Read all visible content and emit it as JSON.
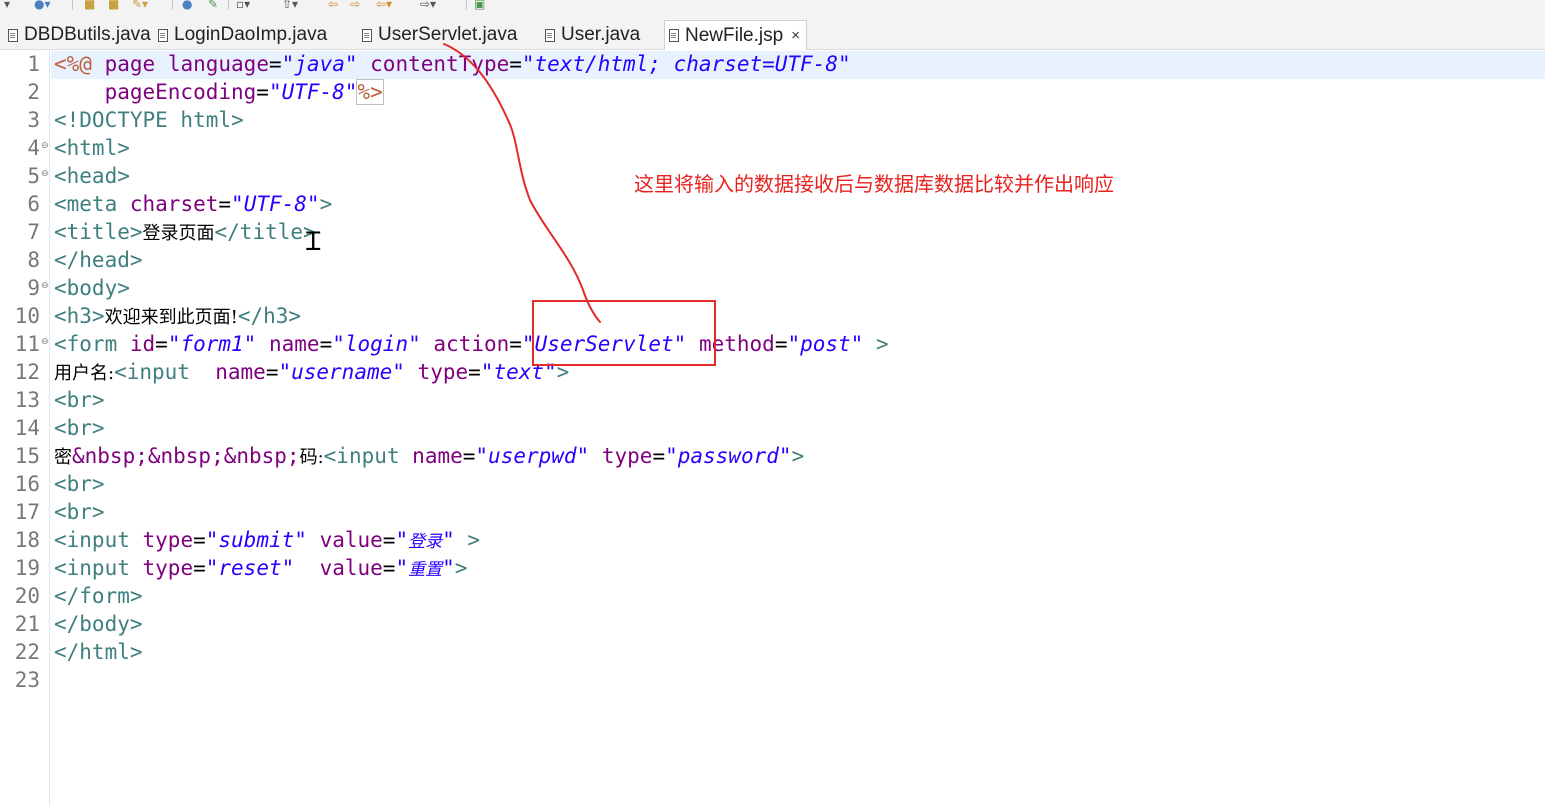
{
  "tabs": [
    {
      "label": "DBDButils.java",
      "active": false
    },
    {
      "label": "LoginDaoImp.java",
      "active": false
    },
    {
      "label": "UserServlet.java",
      "active": false
    },
    {
      "label": "User.java",
      "active": false
    },
    {
      "label": "NewFile.jsp",
      "active": true
    }
  ],
  "tab_close_glyph": "×",
  "editor": {
    "line_numbers": [
      "1",
      "2",
      "3",
      "4",
      "5",
      "6",
      "7",
      "8",
      "9",
      "10",
      "11",
      "12",
      "13",
      "14",
      "15",
      "16",
      "17",
      "18",
      "19",
      "20",
      "21",
      "22",
      "23"
    ],
    "code": {
      "l1": {
        "open": "<%@",
        "page": "page",
        "lang_attr": "language",
        "eq1": "=",
        "lang_val": "\"java\"",
        "ct_attr": "contentType",
        "eq2": "=",
        "ct_val": "\"text/html; charset=UTF-8\""
      },
      "l2": {
        "pe_attr": "pageEncoding",
        "eq": "=",
        "pe_val": "\"UTF-8\"",
        "close": "%>"
      },
      "l3": "<!DOCTYPE html>",
      "l4": "<html>",
      "l5": "<head>",
      "l6": {
        "open": "<meta",
        "attr": "charset",
        "eq": "=",
        "val": "\"UTF-8\"",
        "close": ">"
      },
      "l7": {
        "open": "<title>",
        "text": "登录页面",
        "close": "</title>"
      },
      "l8": "</head>",
      "l9": "<body>",
      "l10": {
        "open": "<h3>",
        "text": "欢迎来到此页面!",
        "close": "</h3>"
      },
      "l11": {
        "open": "<form",
        "id_attr": "id",
        "id_val": "\"form1\"",
        "name_attr": "name",
        "name_val": "\"login\"",
        "action_attr": "action",
        "action_val": "\"UserServlet\"",
        "method_attr": "method",
        "method_val": "\"post\"",
        "close": ">",
        "eq": "="
      },
      "l12": {
        "text": "用户名:",
        "open": "<input",
        "name_attr": "name",
        "name_val": "\"username\"",
        "type_attr": "type",
        "type_val": "\"text\"",
        "close": ">",
        "eq": "="
      },
      "l13": "<br>",
      "l14": "<br>",
      "l15": {
        "text1": "密",
        "entities": "&nbsp;&nbsp;&nbsp;",
        "text2": "码:",
        "open": "<input",
        "name_attr": "name",
        "name_val": "\"userpwd\"",
        "type_attr": "type",
        "type_val": "\"password\"",
        "close": ">",
        "eq": "="
      },
      "l16": "<br>",
      "l17": "<br>",
      "l18": {
        "open": "<input",
        "type_attr": "type",
        "type_val": "\"submit\"",
        "value_attr": "value",
        "q": "\"",
        "value_text": "登录",
        "close": ">",
        "eq": "="
      },
      "l19": {
        "open": "<input",
        "type_attr": "type",
        "type_val": "\"reset\"",
        "value_attr": "value",
        "q": "\"",
        "value_text": "重置",
        "close": ">",
        "eq": "="
      },
      "l20": "</form>",
      "l21": "</body>",
      "l22": "</html>"
    }
  },
  "annotation": {
    "text": "这里将输入的数据接收后与数据库数据比较并作出响应",
    "color": "#e8231f"
  },
  "colors": {
    "tag": "#3f7f7f",
    "attribute": "#7f007f",
    "value": "#2a00ff",
    "directive": "#bf5f3f",
    "current_line": "#e8f2fe"
  },
  "icons": [
    "file-icon",
    "close-icon",
    "fold-icon",
    "text-cursor-icon"
  ]
}
